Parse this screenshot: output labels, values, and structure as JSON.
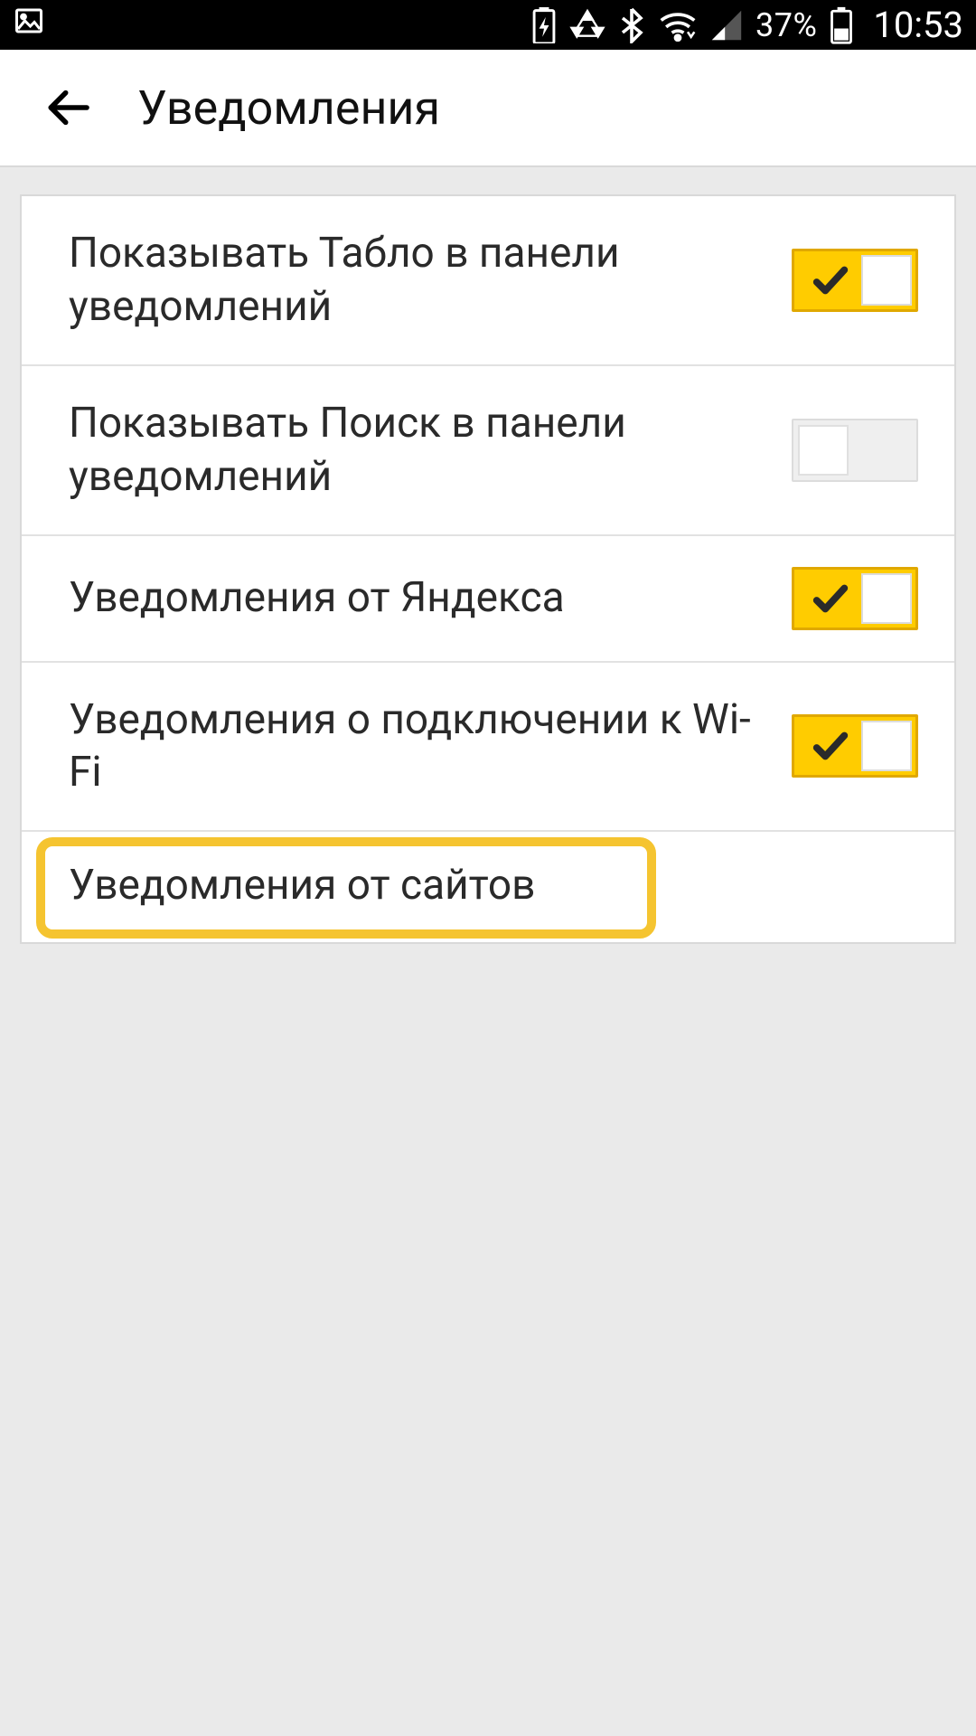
{
  "status": {
    "battery_pct": "37%",
    "clock": "10:53"
  },
  "header": {
    "title": "Уведомления"
  },
  "settings": [
    {
      "label": "Показывать Табло в панели уведомлений",
      "on": true
    },
    {
      "label": "Показывать Поиск в панели уведомлений",
      "on": false
    },
    {
      "label": "Уведомления от Яндекса",
      "on": true
    },
    {
      "label": "Уведомления о подключении к Wi-Fi",
      "on": true
    }
  ],
  "link": {
    "label": "Уведомления от сайтов"
  },
  "colors": {
    "accent": "#ffcc00",
    "highlight_border": "#f5c430"
  }
}
